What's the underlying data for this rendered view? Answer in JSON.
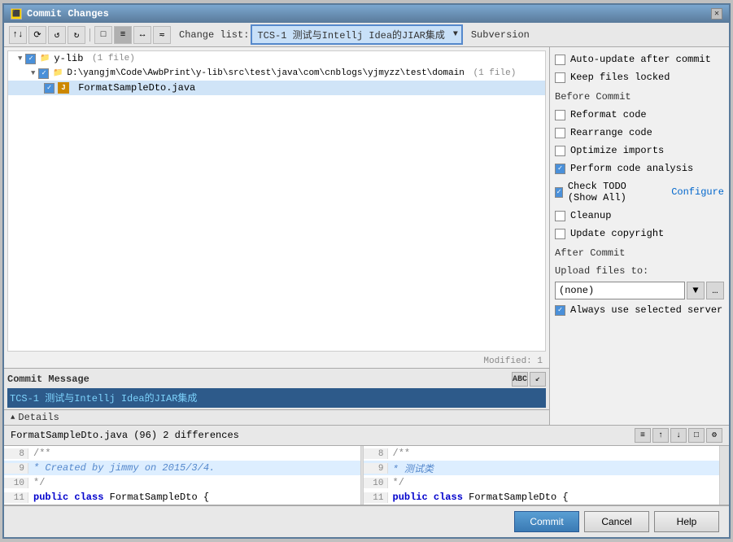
{
  "window": {
    "title": "Commit Changes",
    "close_btn": "✕"
  },
  "toolbar": {
    "changelist_label": "Change list:",
    "changelist_value": "TCS-1 测试与Intellj Idea的JIAR集成",
    "subversion_label": "Subversion",
    "buttons": [
      "⟲",
      "⟳",
      "↺",
      "↻",
      "□",
      "≡",
      "↔",
      "≂"
    ]
  },
  "file_tree": {
    "items": [
      {
        "level": 0,
        "checked": true,
        "type": "folder",
        "label": "y-lib",
        "meta": "(1 file)"
      },
      {
        "level": 1,
        "checked": true,
        "type": "folder",
        "label": "D:\\yangjm\\Code\\AwbPrint\\y-lib\\src\\test\\java\\com\\cnblogs\\yjmyzz\\test\\domain",
        "meta": "(1 file)"
      },
      {
        "level": 2,
        "checked": true,
        "type": "file",
        "label": "FormatSampleDto.java"
      }
    ]
  },
  "modified_label": "Modified: 1",
  "commit_message": {
    "header": "Commit Message",
    "value": "TCS-1 测试与Intellj Idea的JIAR集成"
  },
  "details": {
    "label": "Details"
  },
  "right_panel": {
    "auto_update": {
      "label": "Auto-update after commit",
      "checked": false
    },
    "keep_locked": {
      "label": "Keep files locked",
      "checked": false
    },
    "before_commit_header": "Before Commit",
    "reformat_code": {
      "label": "Reformat code",
      "checked": false
    },
    "rearrange_code": {
      "label": "Rearrange code",
      "checked": false
    },
    "optimize_imports": {
      "label": "Optimize imports",
      "checked": false
    },
    "perform_code_analysis": {
      "label": "Perform code analysis",
      "checked": true
    },
    "check_todo": {
      "label": "Check TODO (Show All)",
      "checked": true
    },
    "configure_link": "Configure",
    "cleanup": {
      "label": "Cleanup",
      "checked": false
    },
    "update_copyright": {
      "label": "Update copyright",
      "checked": false
    },
    "after_commit_header": "After Commit",
    "upload_label": "Upload files to:",
    "upload_value": "(none)",
    "always_use_server": {
      "label": "Always use selected server",
      "checked": true
    }
  },
  "diff_section": {
    "title": "FormatSampleDto.java (96) 2 differences",
    "lines_left": [
      {
        "num": "8",
        "content": "/**",
        "type": "normal"
      },
      {
        "num": "9",
        "content": " * Created by jimmy on 2015/3/4.",
        "type": "highlight"
      },
      {
        "num": "10",
        "content": " */",
        "type": "normal"
      },
      {
        "num": "11",
        "content": "public class FormatSampleDto {",
        "type": "normal"
      }
    ],
    "lines_right": [
      {
        "num": "8",
        "content": "/**",
        "type": "normal"
      },
      {
        "num": "9",
        "content": " * 测试类",
        "type": "highlight"
      },
      {
        "num": "10",
        "content": " */",
        "type": "normal"
      },
      {
        "num": "11",
        "content": "public class FormatSampleDto {",
        "type": "normal"
      }
    ]
  },
  "footer": {
    "commit_label": "Commit",
    "cancel_label": "Cancel",
    "help_label": "Help"
  }
}
